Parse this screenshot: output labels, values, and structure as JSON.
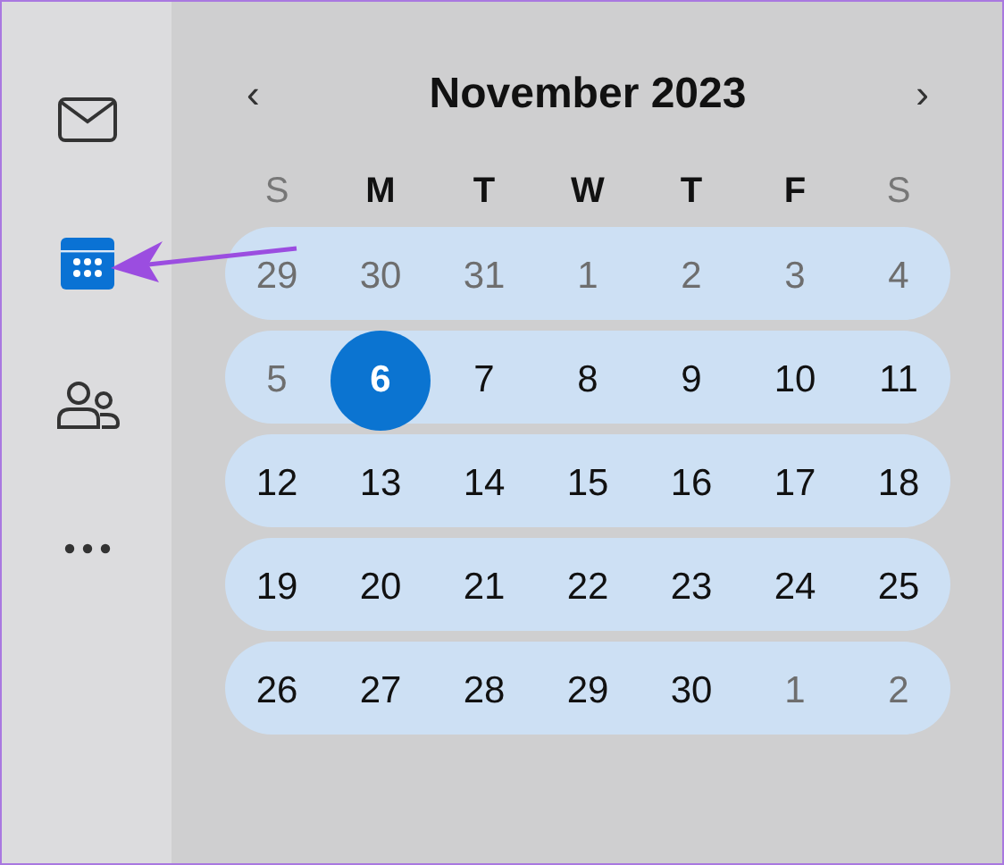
{
  "sidebar": {
    "items": [
      {
        "kind": "mail",
        "selected": false
      },
      {
        "kind": "calendar",
        "selected": true
      },
      {
        "kind": "people",
        "selected": false
      },
      {
        "kind": "more",
        "selected": false
      }
    ]
  },
  "calendar": {
    "title": "November 2023",
    "prev": "‹",
    "next": "›",
    "weekdays": [
      {
        "label": "S",
        "dimmed": true
      },
      {
        "label": "M",
        "dimmed": false
      },
      {
        "label": "T",
        "dimmed": false
      },
      {
        "label": "W",
        "dimmed": false
      },
      {
        "label": "T",
        "dimmed": false
      },
      {
        "label": "F",
        "dimmed": false
      },
      {
        "label": "S",
        "dimmed": true
      }
    ],
    "weeks": [
      [
        {
          "day": "29",
          "dimmed": true,
          "selected": false
        },
        {
          "day": "30",
          "dimmed": true,
          "selected": false
        },
        {
          "day": "31",
          "dimmed": true,
          "selected": false
        },
        {
          "day": "1",
          "dimmed": true,
          "selected": false
        },
        {
          "day": "2",
          "dimmed": true,
          "selected": false
        },
        {
          "day": "3",
          "dimmed": true,
          "selected": false
        },
        {
          "day": "4",
          "dimmed": true,
          "selected": false
        }
      ],
      [
        {
          "day": "5",
          "dimmed": true,
          "selected": false
        },
        {
          "day": "6",
          "dimmed": false,
          "selected": true
        },
        {
          "day": "7",
          "dimmed": false,
          "selected": false
        },
        {
          "day": "8",
          "dimmed": false,
          "selected": false
        },
        {
          "day": "9",
          "dimmed": false,
          "selected": false
        },
        {
          "day": "10",
          "dimmed": false,
          "selected": false
        },
        {
          "day": "11",
          "dimmed": false,
          "selected": false
        }
      ],
      [
        {
          "day": "12",
          "dimmed": false,
          "selected": false
        },
        {
          "day": "13",
          "dimmed": false,
          "selected": false
        },
        {
          "day": "14",
          "dimmed": false,
          "selected": false
        },
        {
          "day": "15",
          "dimmed": false,
          "selected": false
        },
        {
          "day": "16",
          "dimmed": false,
          "selected": false
        },
        {
          "day": "17",
          "dimmed": false,
          "selected": false
        },
        {
          "day": "18",
          "dimmed": false,
          "selected": false
        }
      ],
      [
        {
          "day": "19",
          "dimmed": false,
          "selected": false
        },
        {
          "day": "20",
          "dimmed": false,
          "selected": false
        },
        {
          "day": "21",
          "dimmed": false,
          "selected": false
        },
        {
          "day": "22",
          "dimmed": false,
          "selected": false
        },
        {
          "day": "23",
          "dimmed": false,
          "selected": false
        },
        {
          "day": "24",
          "dimmed": false,
          "selected": false
        },
        {
          "day": "25",
          "dimmed": false,
          "selected": false
        }
      ],
      [
        {
          "day": "26",
          "dimmed": false,
          "selected": false
        },
        {
          "day": "27",
          "dimmed": false,
          "selected": false
        },
        {
          "day": "28",
          "dimmed": false,
          "selected": false
        },
        {
          "day": "29",
          "dimmed": false,
          "selected": false
        },
        {
          "day": "30",
          "dimmed": false,
          "selected": false
        },
        {
          "day": "1",
          "dimmed": true,
          "selected": false
        },
        {
          "day": "2",
          "dimmed": true,
          "selected": false
        }
      ]
    ]
  }
}
